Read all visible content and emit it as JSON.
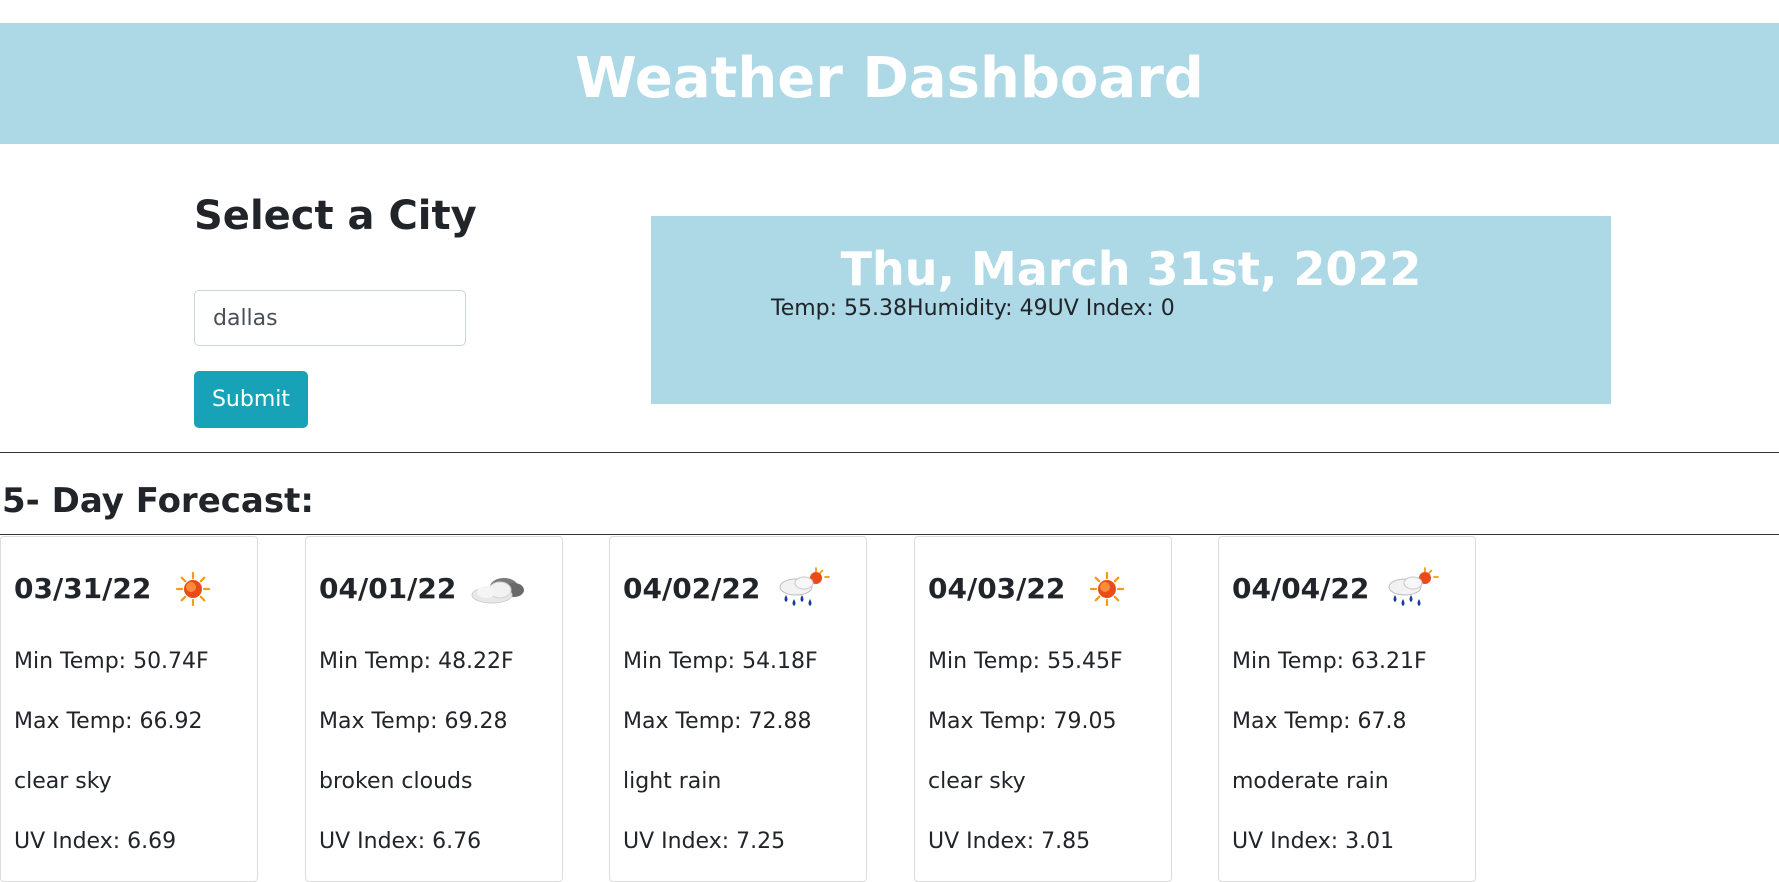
{
  "header": {
    "title": "Weather Dashboard"
  },
  "sidebar": {
    "title": "Select a City",
    "city_input": {
      "value": "dallas",
      "placeholder": ""
    },
    "submit_label": "Submit"
  },
  "current": {
    "date": "Thu, March 31st, 2022",
    "temp": "Temp: 55.38",
    "humidity": "Humidity: 49",
    "uv": "UV Index: 0"
  },
  "forecast": {
    "title": "5- Day Forecast:",
    "days": [
      {
        "date": "03/31/22",
        "icon": "sun-icon",
        "min": "Min Temp: 50.74F",
        "max": "Max Temp: 66.92",
        "desc": "clear sky",
        "uv": "UV Index: 6.69"
      },
      {
        "date": "04/01/22",
        "icon": "cloud-icon",
        "min": "Min Temp: 48.22F",
        "max": "Max Temp: 69.28",
        "desc": "broken clouds",
        "uv": "UV Index: 6.76"
      },
      {
        "date": "04/02/22",
        "icon": "rain-sun-icon",
        "min": "Min Temp: 54.18F",
        "max": "Max Temp: 72.88",
        "desc": "light rain",
        "uv": "UV Index: 7.25"
      },
      {
        "date": "04/03/22",
        "icon": "sun-icon",
        "min": "Min Temp: 55.45F",
        "max": "Max Temp: 79.05",
        "desc": "clear sky",
        "uv": "UV Index: 7.85"
      },
      {
        "date": "04/04/22",
        "icon": "rain-sun-icon",
        "min": "Min Temp: 63.21F",
        "max": "Max Temp: 67.8",
        "desc": "moderate rain",
        "uv": "UV Index: 3.01"
      }
    ]
  },
  "colors": {
    "header_bg": "#add8e6",
    "submit_bg": "#17a2b8"
  }
}
